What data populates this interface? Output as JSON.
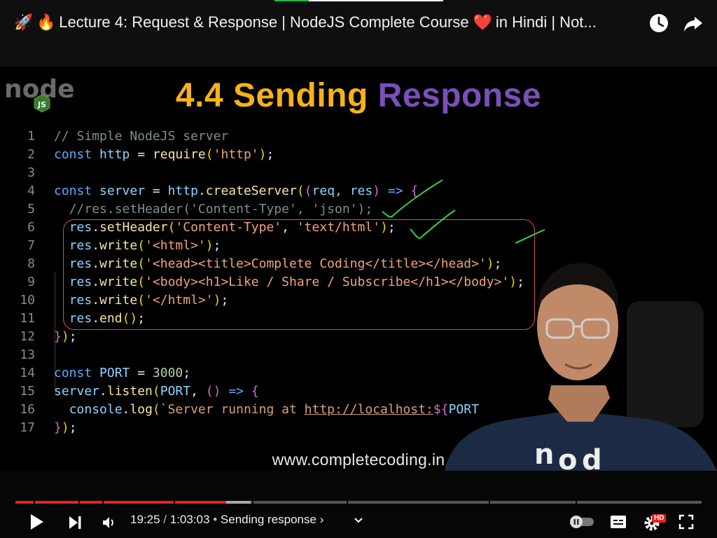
{
  "video_title": {
    "emoji_1": "🚀",
    "emoji_2": "🔥",
    "text_before_heart": "Lecture 4: Request & Response | NodeJS Complete Course",
    "emoji_heart": "❤️",
    "text_after_heart": "in Hindi | Not..."
  },
  "top_actions": {
    "watch_later_icon": "clock-icon",
    "share_icon": "share-arrow-icon"
  },
  "slide": {
    "logo_text": "node",
    "logo_badge": "JS",
    "title_part1": "4.4 Sending",
    "title_part2": "Response",
    "website": "www.completecoding.in"
  },
  "code": {
    "line_numbers": [
      "1",
      "2",
      "3",
      "4",
      "5",
      "6",
      "7",
      "8",
      "9",
      "10",
      "11",
      "12",
      "13",
      "14",
      "15",
      "16",
      "17"
    ],
    "l1": "// Simple NodeJS server",
    "l2_kw": "const",
    "l2_var": "http",
    "l2_eq": " = ",
    "l2_fn": "require",
    "l2_str": "'http'",
    "l4_kw": "const",
    "l4_var": "server",
    "l4_eq": " = ",
    "l4_obj": "http",
    "l4_fn": "createServer",
    "l4_args": "req, res",
    "l4_arrow": "=>",
    "l5": "//res.setHeader('Content-Type', 'json');",
    "l6_obj": "res",
    "l6_fn": "setHeader",
    "l6_str1": "'Content-Type'",
    "l6_str2": "'text/html'",
    "l7_str": "'<html>'",
    "l8_str": "'<head><title>Complete Coding</title></head>'",
    "l9_str": "'<body><h1>Like / Share / Subscribe</h1></body>'",
    "l10_str": "'</html>'",
    "write_fn": "write",
    "end_fn": "end",
    "l14_kw": "const",
    "l14_var": "PORT",
    "l14_num": "3000",
    "l15_obj": "server",
    "l15_fn": "listen",
    "l15_arg": "PORT",
    "l16_obj": "console",
    "l16_fn": "log",
    "l16_tpl": "`Server running at ",
    "l16_url": "http://localhost:",
    "l16_interp_start": "${",
    "l16_interp_var": "PORT"
  },
  "player": {
    "current_time": "19:25",
    "separator": "/",
    "duration": "1:03:03",
    "bullet": "•",
    "chapter": "Sending response",
    "chapter_chevron": "›",
    "progress_fraction": 0.3076,
    "buffered_fraction": 0.343,
    "icons": {
      "play": "play-icon",
      "next": "skip-next-icon",
      "volume": "volume-icon",
      "chapters_expand": "chevron-down-icon",
      "autoplay": "autoplay-toggle-icon",
      "captions": "captions-icon",
      "settings": "gear-icon",
      "fullscreen": "fullscreen-icon"
    },
    "hd_badge": "HD",
    "accent_color": "#e62121"
  }
}
